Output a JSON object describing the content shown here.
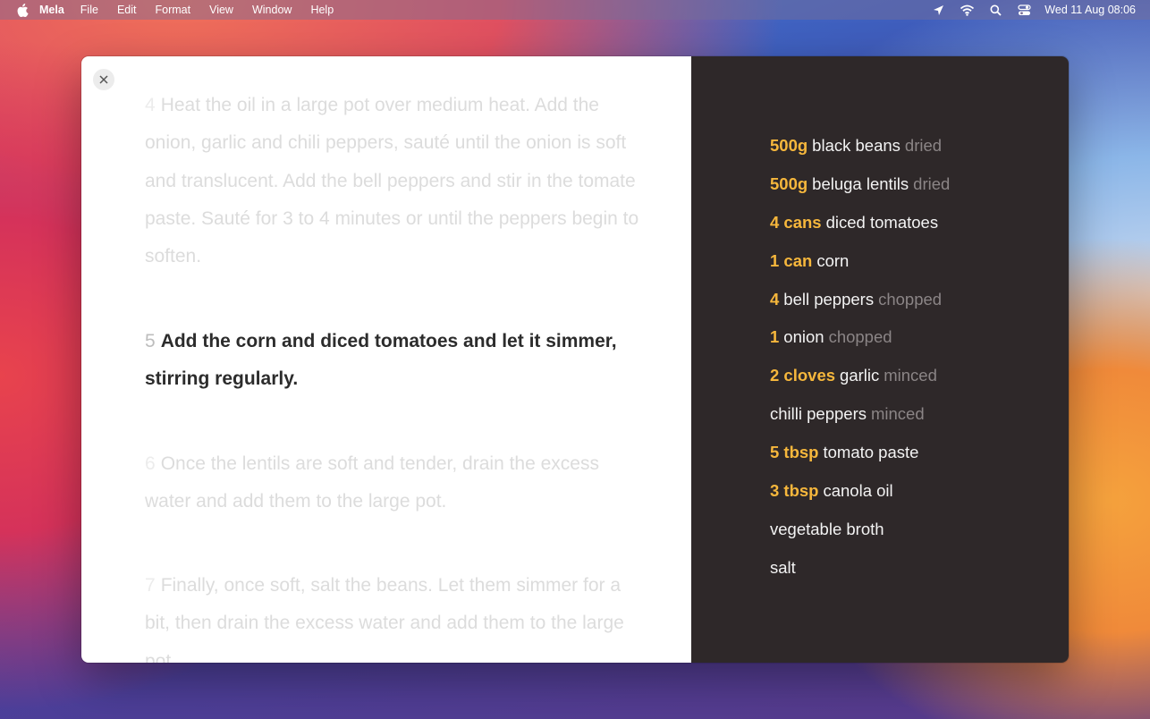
{
  "menubar": {
    "app_name": "Mela",
    "menus": [
      "File",
      "Edit",
      "Format",
      "View",
      "Window",
      "Help"
    ],
    "clock": "Wed 11 Aug  08:06",
    "status_icons": [
      "location-icon",
      "wifi-icon",
      "search-icon",
      "control-center-icon"
    ]
  },
  "steps": [
    {
      "number": "4",
      "text": "Heat the oil in a large pot over medium heat. Add the onion, garlic and chili peppers, sauté until the onion is soft and translucent. Add the bell peppers and stir in the tomate paste. Sauté for 3 to 4 minutes or until the peppers begin to soften.",
      "active": false
    },
    {
      "number": "5",
      "text": "Add the corn and diced tomatoes and let it simmer, stirring regularly.",
      "active": true
    },
    {
      "number": "6",
      "text": "Once the lentils are soft and tender, drain the excess water and add them to the large pot.",
      "active": false
    },
    {
      "number": "7",
      "text": "Finally, once soft, salt the beans. Let them simmer for a bit, then drain the excess water and add them to the large pot.",
      "active": false
    }
  ],
  "ingredients": [
    {
      "qty": "500g",
      "name": "black beans",
      "note": "dried"
    },
    {
      "qty": "500g",
      "name": "beluga lentils",
      "note": "dried"
    },
    {
      "qty": "4 cans",
      "name": "diced tomatoes",
      "note": ""
    },
    {
      "qty": "1 can",
      "name": "corn",
      "note": ""
    },
    {
      "qty": "4",
      "name": "bell peppers",
      "note": "chopped"
    },
    {
      "qty": "1",
      "name": "onion",
      "note": "chopped"
    },
    {
      "qty": "2 cloves",
      "name": "garlic",
      "note": "minced"
    },
    {
      "qty": "",
      "name": "chilli peppers",
      "note": "minced"
    },
    {
      "qty": "5 tbsp",
      "name": "tomato paste",
      "note": ""
    },
    {
      "qty": "3 tbsp",
      "name": "canola oil",
      "note": ""
    },
    {
      "qty": "",
      "name": "vegetable broth",
      "note": ""
    },
    {
      "qty": "",
      "name": "salt",
      "note": ""
    }
  ],
  "colors": {
    "quantity": "#f6b73c",
    "ingredients_bg": "#2e2829",
    "active_step": "#2c2c2c",
    "inactive_step": "#dcdcdc"
  }
}
